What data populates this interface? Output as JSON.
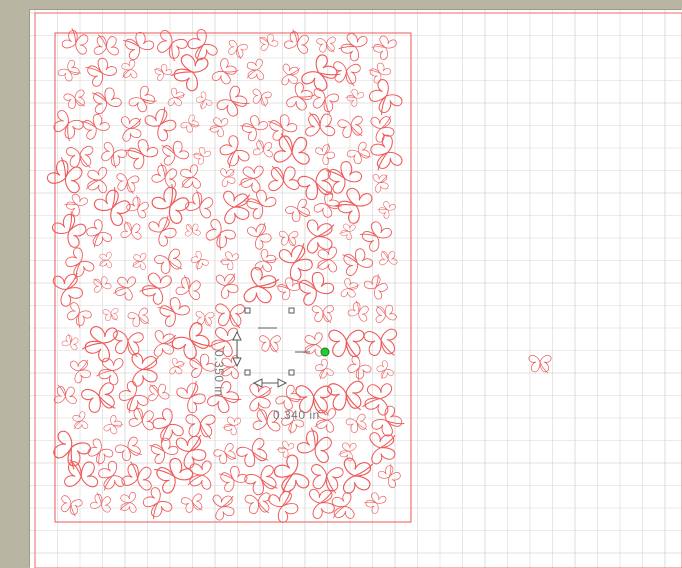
{
  "workspace": {
    "grid_color": "#d7d7d7",
    "cutting_mat_border_color": "#f06a6a",
    "shape_color": "#ee5a5a",
    "rotate_handle_color": "#22cc33",
    "selection_color": "#5b5b5b"
  },
  "design": {
    "shape": "shamrock-icon",
    "pattern_name": "shamrock-pattern"
  },
  "selection": {
    "width_label": "0.340 in",
    "height_label": "0.350 in"
  }
}
